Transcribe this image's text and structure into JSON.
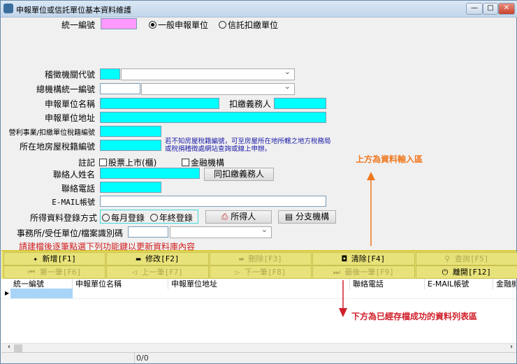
{
  "window": {
    "title": "申報單位或信託單位基本資料維護",
    "minimize": "—",
    "maximize": "□",
    "close": "✕"
  },
  "form": {
    "ban_label": "統一編號",
    "unit_type_options": [
      {
        "label": "一般申報單位",
        "selected": true
      },
      {
        "label": "信託扣繳單位",
        "selected": false
      }
    ],
    "tax_office_label": "稽徵機關代號",
    "hq_ban_label": "總機構統一編號",
    "unit_name_label": "申報單位名稱",
    "withholder_label": "扣繳義務人",
    "address_label": "申報單位地址",
    "business_tax_id_label": "營利事業/扣繳單位稅籍編號",
    "house_tax_id_label": "所在地房屋稅籍編號",
    "house_tax_note": "若不知房屋稅籍編號，可至房屋所在地所轄之地方稅務局或稅捐稽徵處網站查詢或線上申辦。",
    "remark_label": "註記",
    "listed_label": "股票上市(櫃)",
    "financial_label": "金融機構",
    "contact_name_label": "聯絡人姓名",
    "same_as_withholder_button": "同扣繳義務人",
    "phone_label": "聯絡電話",
    "email_label": "E-MAIL帳號",
    "entry_method_label": "所得資料登錄方式",
    "entry_options": [
      {
        "label": "每月登錄",
        "selected": false
      },
      {
        "label": "年終登錄",
        "selected": false
      }
    ],
    "income_person_button": "所得人",
    "branch_button": "分支機構",
    "office_label": "事務所/受任單位/檔案識別碼",
    "hint": "請建檔後逐筆點選下列功能鍵以更新資料庫內容"
  },
  "function_keys": [
    {
      "label": "新增[F1]",
      "icon": "✦",
      "enabled": true
    },
    {
      "label": "修改[F2]",
      "icon": "▬",
      "enabled": true
    },
    {
      "label": "刪除[F3]",
      "icon": "▬",
      "enabled": false
    },
    {
      "label": "清除[F4]",
      "icon": "◘",
      "enabled": true
    },
    {
      "label": "查詢[F5]",
      "icon": "⚲",
      "enabled": false
    },
    {
      "label": "第一筆[F6]",
      "icon": "⏮",
      "enabled": false
    },
    {
      "label": "上一筆[F7]",
      "icon": "◁",
      "enabled": false
    },
    {
      "label": "下一筆[F8]",
      "icon": "▷",
      "enabled": false
    },
    {
      "label": "最後一筆[F9]",
      "icon": "⏭",
      "enabled": false
    },
    {
      "label": "離開[F12]",
      "icon": "⏻",
      "enabled": true
    }
  ],
  "grid": {
    "columns": [
      "統一編號",
      "申報單位名稱",
      "申報單位地址",
      "聯絡電話",
      "E-MAIL帳號",
      "金融機"
    ]
  },
  "status": {
    "record_count": "0/0"
  },
  "annotations": {
    "top": "上方為資料輸入區",
    "bottom": "下方為已經存檔成功的資料列表區",
    "top_color": "#f07820",
    "bottom_color": "#d0202a"
  }
}
